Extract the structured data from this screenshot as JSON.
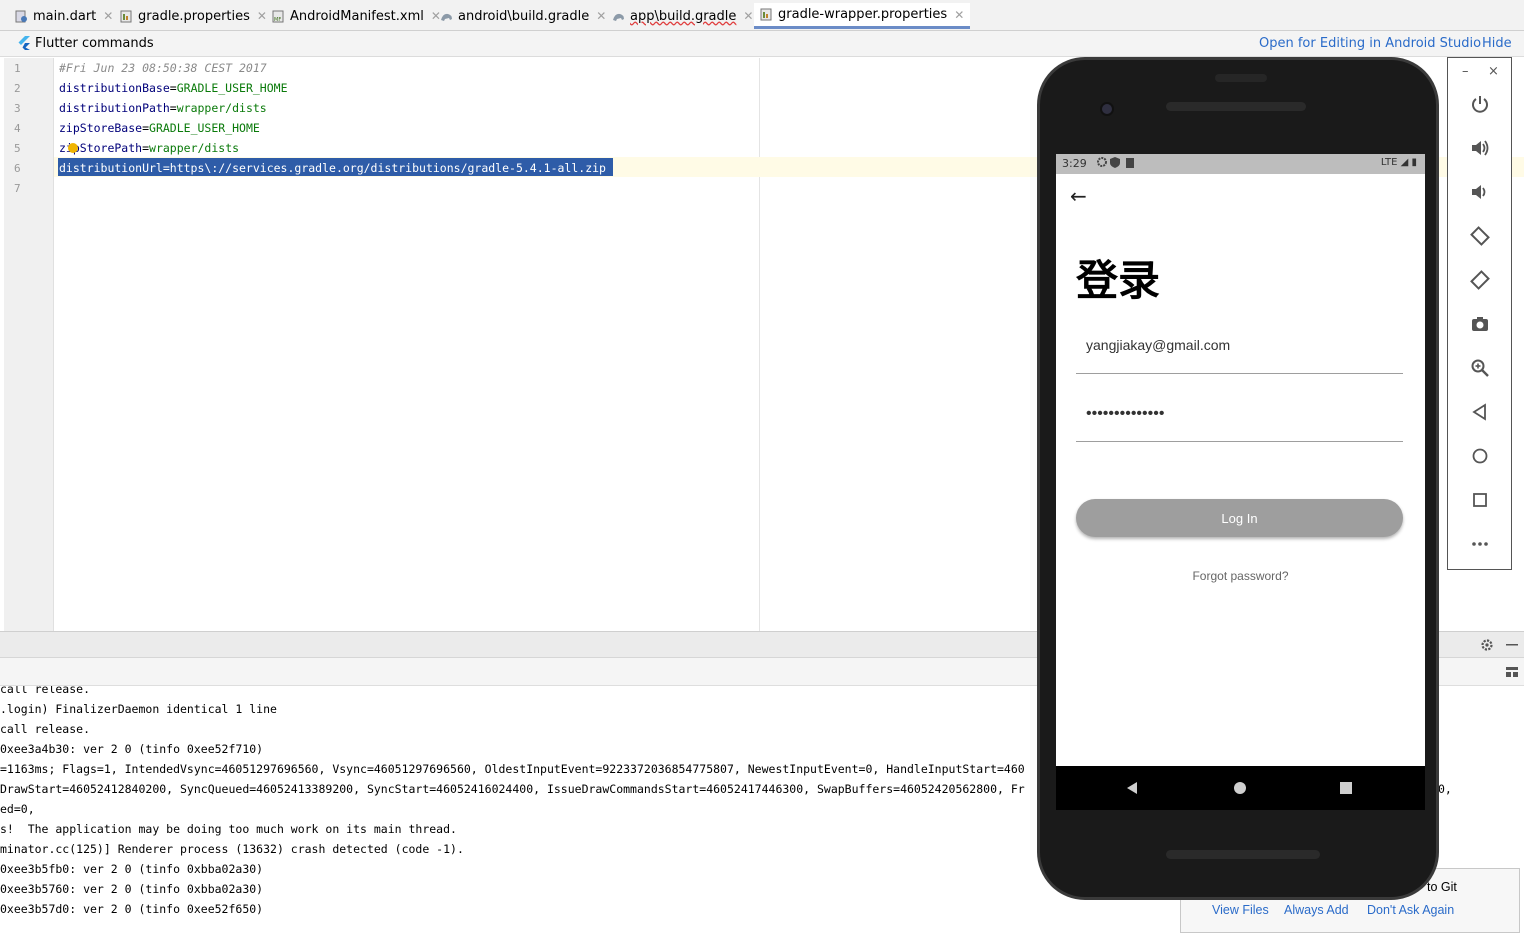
{
  "tabs": [
    {
      "label": "main.dart",
      "icon": "dart-file-icon"
    },
    {
      "label": "gradle.properties",
      "icon": "properties-file-icon"
    },
    {
      "label": "AndroidManifest.xml",
      "icon": "manifest-file-icon"
    },
    {
      "label": "android\\build.gradle",
      "icon": "gradle-file-icon"
    },
    {
      "label": "app\\build.gradle",
      "icon": "gradle-file-icon"
    },
    {
      "label": "gradle-wrapper.properties",
      "icon": "properties-file-icon"
    }
  ],
  "banner": {
    "title": "Flutter commands",
    "open_link": "Open for Editing in Android Studio",
    "hide_link": "Hide"
  },
  "editor": {
    "line_numbers": [
      "1",
      "2",
      "3",
      "4",
      "5",
      "6",
      "7"
    ],
    "lines": [
      {
        "comment": "#Fri Jun 23 08:50:38 CEST 2017"
      },
      {
        "key": "distributionBase",
        "value": "GRADLE_USER_HOME"
      },
      {
        "key": "distributionPath",
        "value": "wrapper/dists"
      },
      {
        "key": "zipStoreBase",
        "value": "GRADLE_USER_HOME"
      },
      {
        "key": "zipStorePath",
        "value": "wrapper/dists"
      },
      {
        "full": "distributionUrl=https\\://services.gradle.org/distributions/gradle-5.4.1-all.zip"
      }
    ],
    "equals": "="
  },
  "console": [
    "call release.",
    ".login) FinalizerDaemon identical 1 line",
    "call release.",
    "0xee3a4b30: ver 2 0 (tinfo 0xee52f710)",
    "=1163ms; Flags=1, IntendedVsync=46051297696560, Vsync=46051297696560, OldestInputEvent=9223372036854775807, NewestInputEvent=0, HandleInputStart=460",
    "DrawStart=46052412840200, SyncQueued=46052413389200, SyncStart=46052416024400, IssueDrawCommandsStart=46052417446300, SwapBuffers=46052420562800, Fr",
    "ed=0,",
    "s!  The application may be doing too much work on its main thread.",
    "minator.cc(125)] Renderer process (13632) crash detected (code -1).",
    "0xee3b5fb0: ver 2 0 (tinfo 0xbba02a30)",
    "0xee3b5760: ver 2 0 (tinfo 0xbba02a30)",
    "0xee3b57d0: ver 2 0 (tinfo 0xee52f650)"
  ],
  "console_tail": "0,",
  "phone": {
    "status_time": "3:29",
    "status_net": "LTE",
    "heading": "登录",
    "email_value": "yangjiakay@gmail.com",
    "password_value": "••••••••••••••",
    "login_label": "Log In",
    "forgot_label": "Forgot password?"
  },
  "emulator_toolbar": {
    "minimize": "–",
    "close": "×",
    "buttons": [
      "power-icon",
      "volume-up-icon",
      "volume-down-icon",
      "rotate-left-icon",
      "rotate-right-icon",
      "camera-icon",
      "zoom-icon",
      "back-icon",
      "home-icon",
      "overview-icon",
      "more-icon"
    ]
  },
  "git_popup": {
    "message": "to Git",
    "view_files": "View Files",
    "always_add": "Always Add",
    "dont_ask": "Don't Ask Again"
  },
  "colors": {
    "accent": "#2a6bc9",
    "selection": "#2e5ca8",
    "key": "#00007a",
    "value": "#0a7a0a"
  }
}
